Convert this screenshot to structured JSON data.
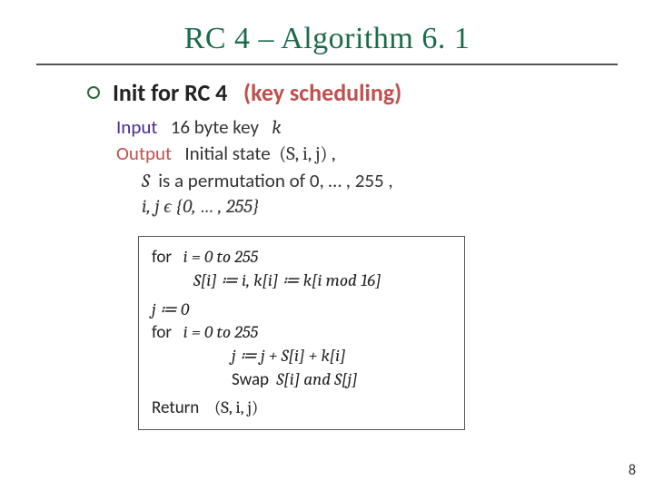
{
  "title": "RC 4 – Algorithm 6. 1",
  "bullet": {
    "prefix_bold": "Init for RC 4",
    "paren_text": "(key scheduling)"
  },
  "io": {
    "input_label": "Input",
    "input_text": "16 byte key",
    "input_var": "k",
    "output_label": "Output",
    "output_text": "Initial state",
    "output_tuple": "(S, i, j) ,",
    "perm_line_pre": "S",
    "perm_line_text": "is a permutation of 0, … , 255 ,",
    "ij_line": "i, j ϵ {0, … , 255}"
  },
  "algo": {
    "for1_kw": "for",
    "for1_cond": "i = 0 to 255",
    "for1_body": "S[i] ≔ i,  k[i] ≔ k[i mod 16]",
    "j_init": "j ≔ 0",
    "for2_kw": "for",
    "for2_cond": "i = 0 to 255",
    "for2_body1": "j ≔ j + S[i] + k[i]",
    "for2_body2_pre": "Swap",
    "for2_body2_rest": "S[i] and S[j]",
    "return_kw": "Return",
    "return_val": "(S, i, j)"
  },
  "page_number": "8"
}
